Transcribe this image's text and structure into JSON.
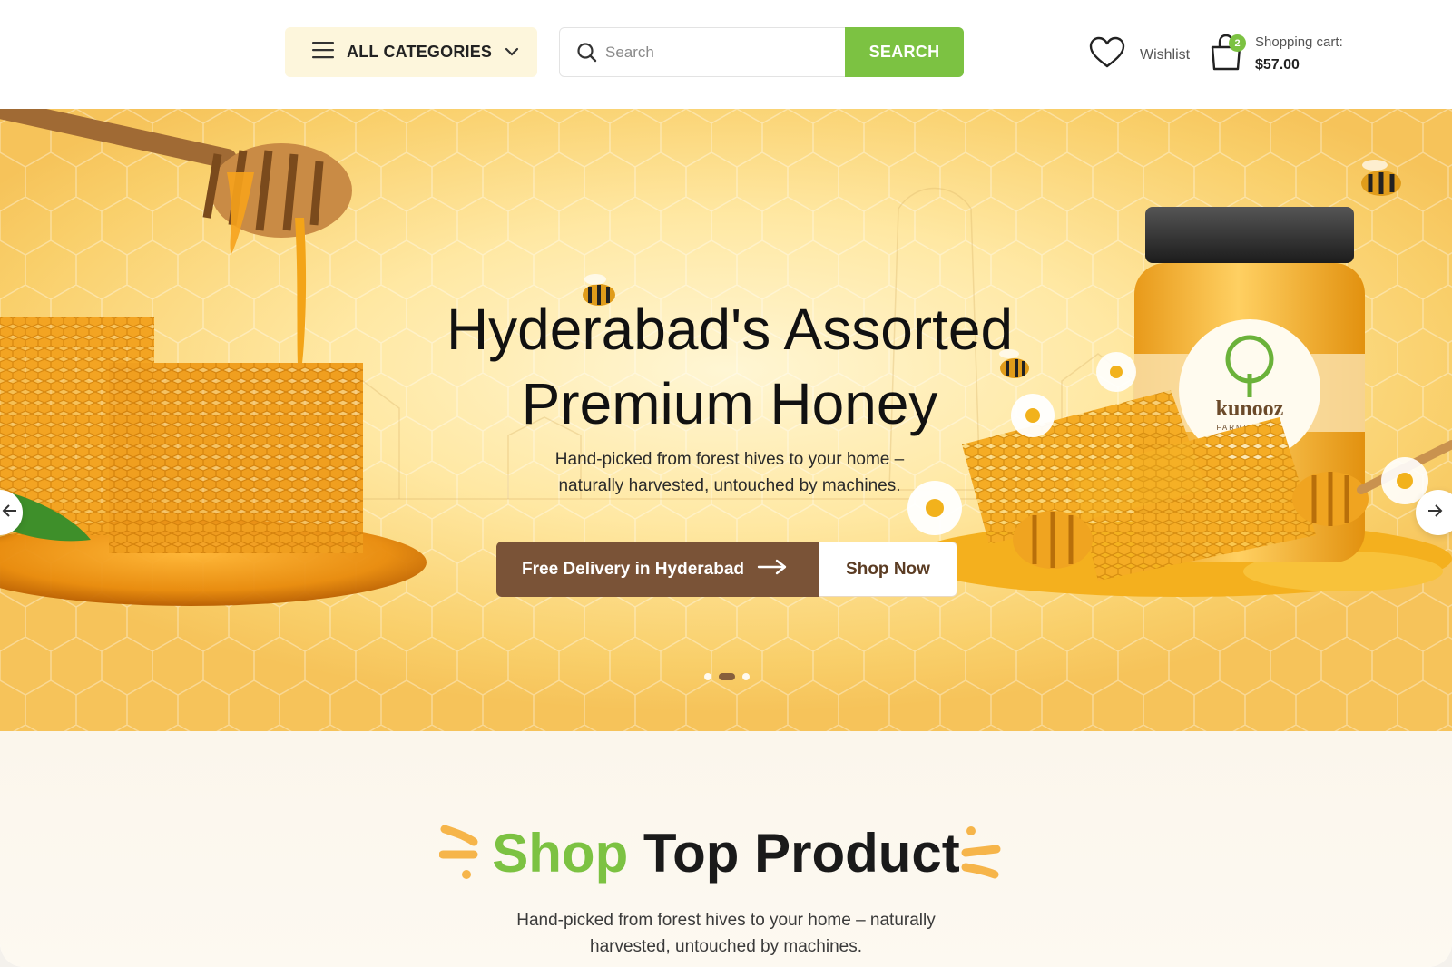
{
  "header": {
    "categories_label": "ALL CATEGORIES",
    "search": {
      "placeholder": "Search",
      "button_label": "SEARCH"
    },
    "wishlist_label": "Wishlist",
    "cart": {
      "badge_count": "2",
      "label": "Shopping cart:",
      "total": "$57.00"
    }
  },
  "hero": {
    "title_line1": "Hyderabad's Assorted",
    "title_line2": "Premium Honey",
    "subtitle_line1": "Hand-picked from forest hives to your home –",
    "subtitle_line2": "naturally harvested, untouched by machines.",
    "delivery_label": "Free Delivery in Hyderabad",
    "shop_now_label": "Shop Now",
    "brand_name": "kunooz",
    "brand_tagline": "FARMS INDIA",
    "slides_total": 3,
    "active_slide": 2
  },
  "section": {
    "title_highlight": "Shop",
    "title_rest": "Top Product",
    "subtitle_line1": "Hand-picked from forest hives to your home – naturally",
    "subtitle_line2": "harvested, untouched by machines."
  },
  "colors": {
    "accent_green": "#7cc242",
    "brown": "#7a5337",
    "honey": "#f6c35a",
    "cream": "#fdf6dc"
  }
}
